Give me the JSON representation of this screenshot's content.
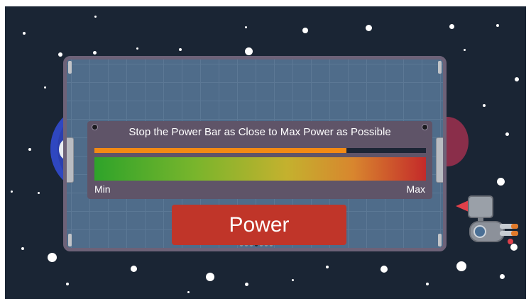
{
  "game": {
    "instruction": "Stop the Power Bar as Close to Max Power as Possible",
    "min_label": "Min",
    "max_label": "Max",
    "power_button_label": "Power",
    "timing_bar_fill_fraction": 0.76,
    "page_indicator": {
      "count": 7,
      "active_index": 3
    }
  },
  "colors": {
    "space": "#1a2534",
    "panel": "#4f6c8a",
    "panel_border": "#6d6278",
    "card": "#5f5468",
    "timing_fill": "#f28a14",
    "power_button": "#c03529",
    "gradient_start": "#2ea32a",
    "gradient_end": "#c42a2a"
  },
  "icons": {
    "left_planet": "planet-icon",
    "spaceship": "spaceship-icon"
  }
}
